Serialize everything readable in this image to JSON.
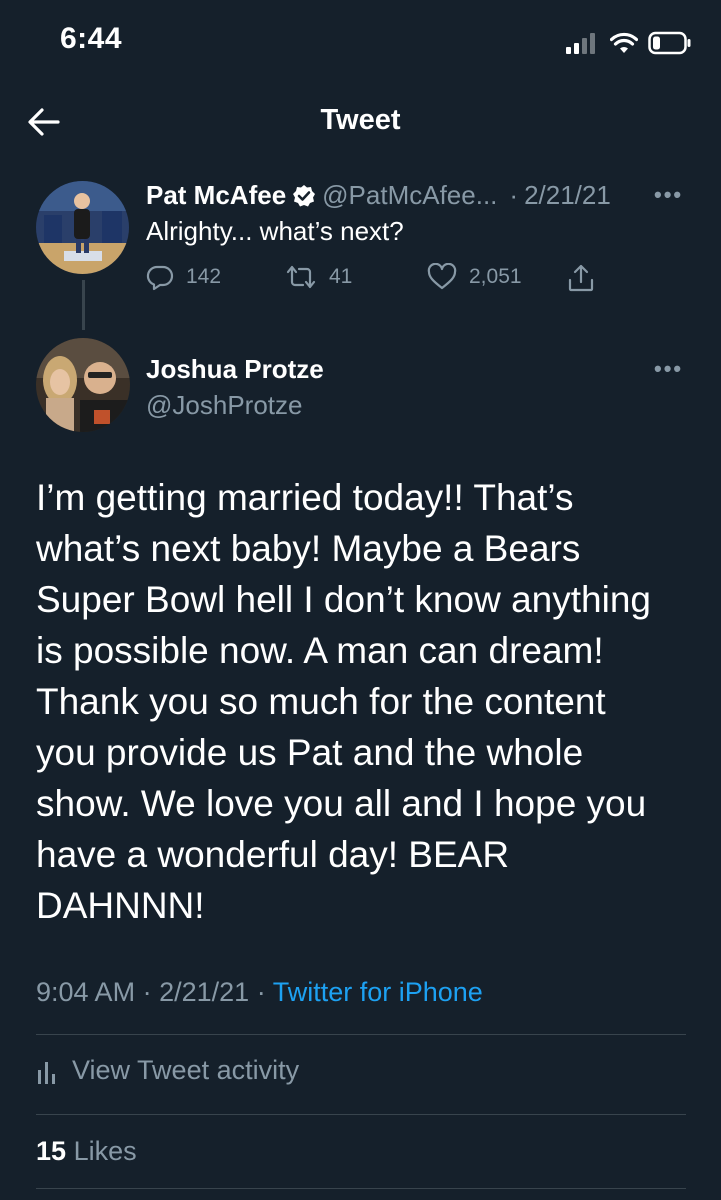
{
  "status_bar": {
    "time": "6:44"
  },
  "header": {
    "title": "Tweet"
  },
  "quoted_tweet": {
    "author_name": "Pat McAfee",
    "author_handle": "@PatMcAfee...",
    "separator": "·",
    "date": "2/21/21",
    "text": "Alrighty... what’s next?",
    "reply_count": "142",
    "retweet_count": "41",
    "like_count": "2,051",
    "verified": true
  },
  "tweet": {
    "author_name": "Joshua Protze",
    "author_handle": "@JoshProtze",
    "text": "I’m getting married today!! That’s\nwhat’s next baby! Maybe a Bears\nSuper Bowl hell I don’t know anything\nis possible now. A man can dream!\nThank you so much for the content\nyou provide us Pat and the whole\nshow. We love you all and I hope you\nhave a wonderful day! BEAR\nDAHNNN!",
    "time": "9:04 AM",
    "date": "2/21/21",
    "source": "Twitter for iPhone",
    "view_activity_label": "View Tweet activity",
    "likes_count": "15",
    "likes_label": "Likes"
  },
  "colors": {
    "background": "#15202b",
    "secondary_text": "#8899a6",
    "accent": "#1da1f2",
    "divider": "#38444d"
  }
}
